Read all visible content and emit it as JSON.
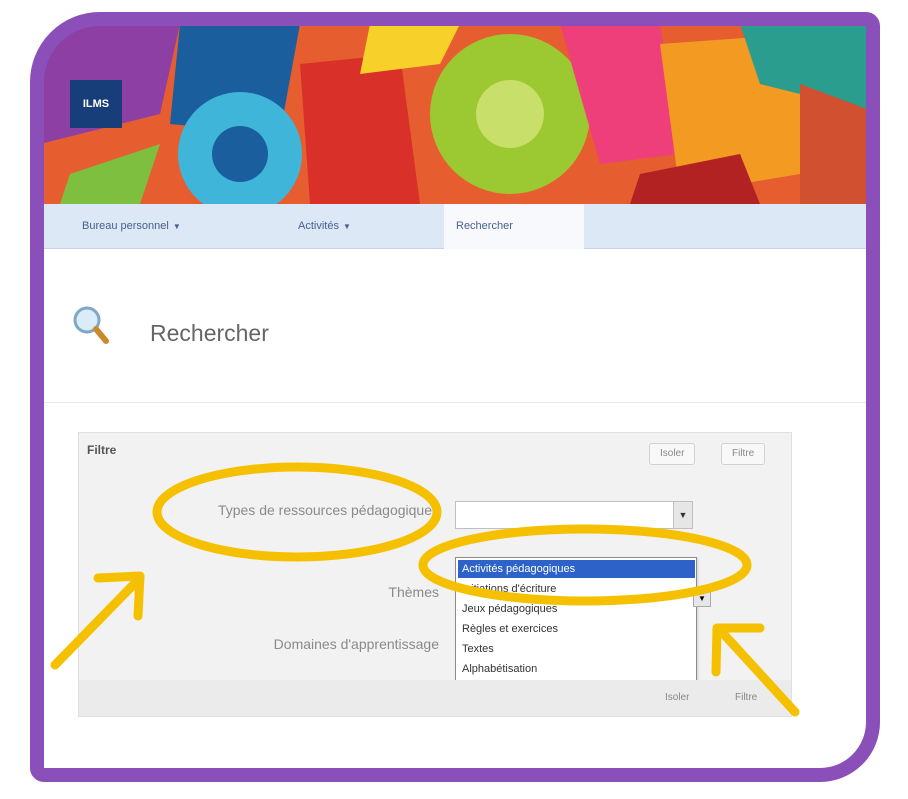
{
  "banner": {
    "logo_text": "ILMS",
    "colors": [
      "#1b5e9e",
      "#e63c2f",
      "#7cc041",
      "#f7a81b",
      "#3fb6d9",
      "#8e3fa3",
      "#f58c23",
      "#b22222"
    ]
  },
  "nav": {
    "items": [
      {
        "label": "Bureau personnel",
        "has_dropdown": true
      },
      {
        "label": "Activités",
        "has_dropdown": true
      },
      {
        "label": "Rechercher",
        "has_dropdown": false,
        "active": true
      }
    ],
    "dropdown_glyph": "▼"
  },
  "page": {
    "title": "Rechercher",
    "icon": "search-icon"
  },
  "filter": {
    "header_label": "Filtre",
    "buttons": [
      "Isoler",
      "Filtre"
    ],
    "fields": [
      {
        "label": "Types de ressources pédagogiques"
      },
      {
        "label": "Thèmes"
      },
      {
        "label": "Domaines d'apprentissage"
      }
    ],
    "dropdown_options": [
      "Activités pédagogiques",
      "Initiations d'écriture",
      "Jeux pédagogiques",
      "Règles et exercices",
      "Textes",
      "Alphabétisation"
    ],
    "selected_index": 0,
    "footer_buttons": [
      "Isoler",
      "Filtre"
    ]
  },
  "annotations": {
    "highlight_color": "#f5c000",
    "frame_color": "#8a4fb8",
    "arrow_icon": "arrow-icon"
  }
}
